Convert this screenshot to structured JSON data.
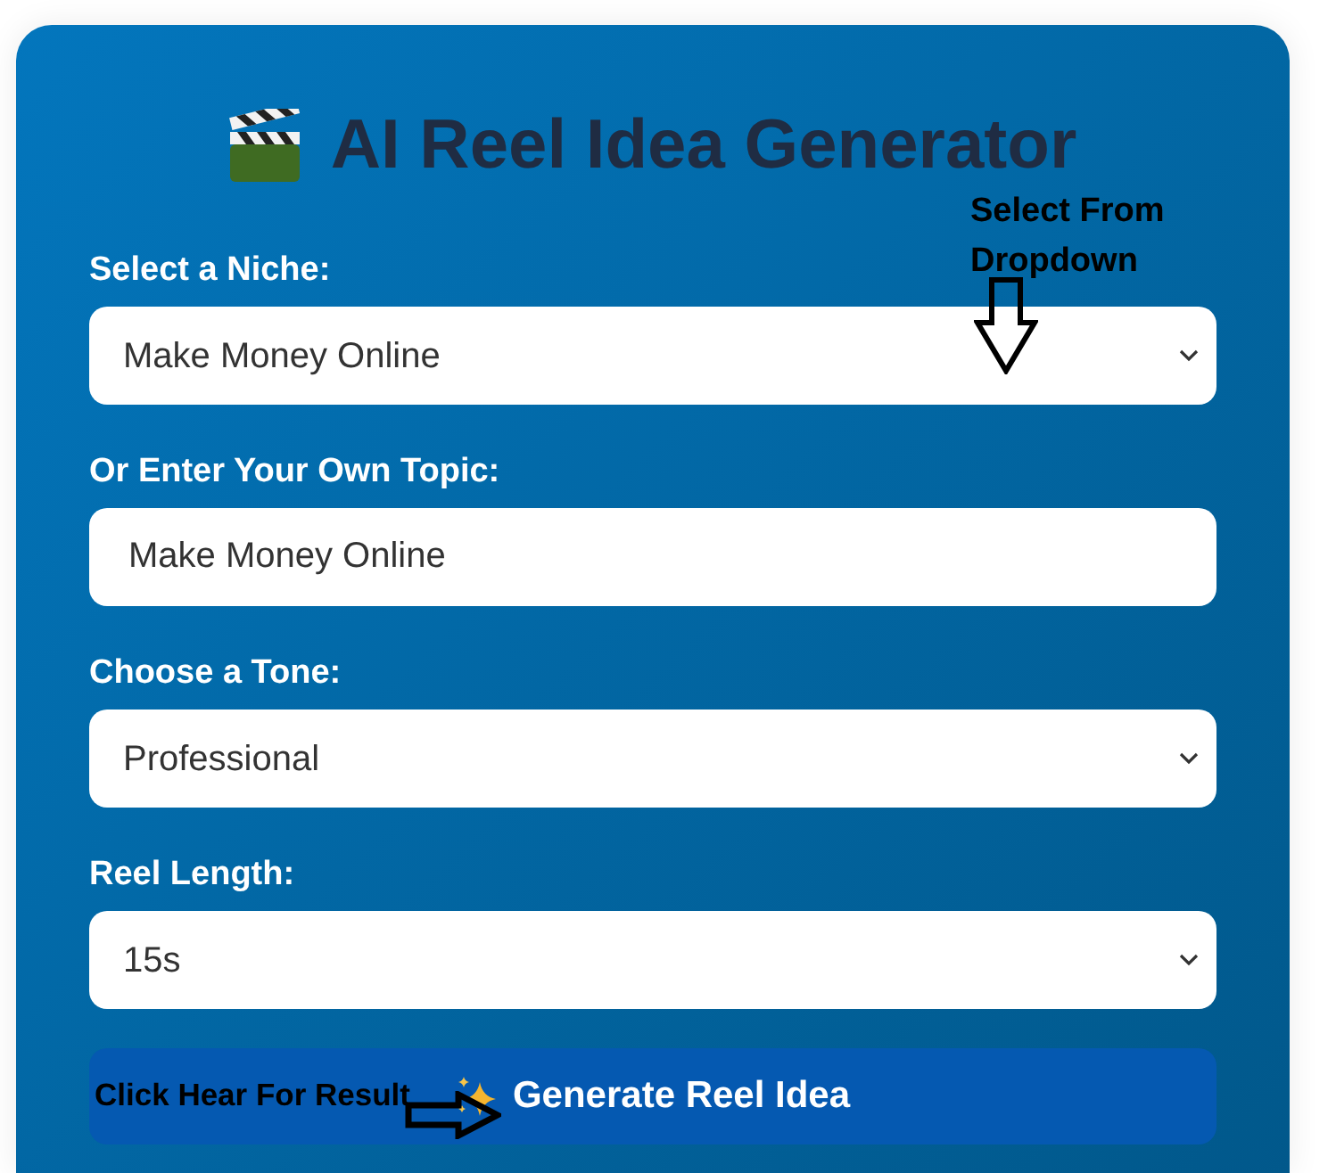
{
  "title": "AI Reel Idea Generator",
  "fields": [
    {
      "kind": "select",
      "label": "Select a Niche:",
      "value": "Make Money Online"
    },
    {
      "kind": "text",
      "label": "Or Enter Your Own Topic:",
      "value": "Make Money Online"
    },
    {
      "kind": "select",
      "label": "Choose a Tone:",
      "value": "Professional"
    },
    {
      "kind": "select",
      "label": "Reel Length:",
      "value": "15s"
    }
  ],
  "generate_button": {
    "label": "Generate Reel Idea"
  },
  "annotations": [
    {
      "kind": "down",
      "text": "Select From Dropdown"
    },
    {
      "kind": "right",
      "text": "Click Hear For Result"
    }
  ]
}
